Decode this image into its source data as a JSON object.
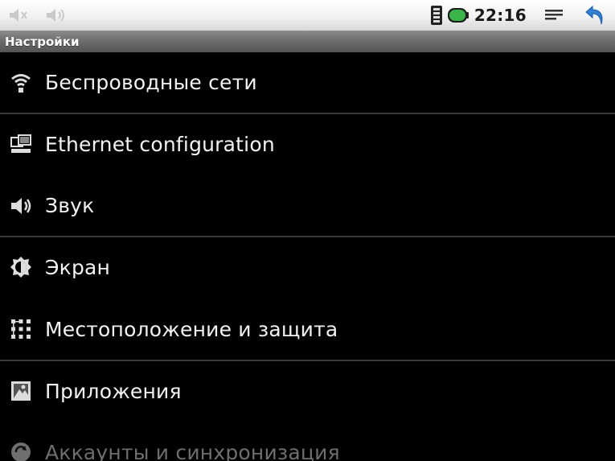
{
  "status_bar": {
    "left_icons": [
      "volume-muted-icon",
      "volume-low-icon"
    ],
    "clock": "22:16",
    "right_icons": [
      "sim-signal-icon",
      "battery-icon",
      "menu-icon",
      "back-icon"
    ],
    "colors": {
      "battery_fill": "#39b54a",
      "back_arrow": "#2f7fd8"
    }
  },
  "title_bar": {
    "title": "Настройки"
  },
  "settings": {
    "items": [
      {
        "label": "Беспроводные сети",
        "icon": "wifi-icon"
      },
      {
        "label": "Ethernet configuration",
        "icon": "ethernet-icon"
      },
      {
        "label": "Звук",
        "icon": "speaker-icon"
      },
      {
        "label": "Экран",
        "icon": "brightness-icon"
      },
      {
        "label": "Местоположение и защита",
        "icon": "location-grid-icon"
      },
      {
        "label": "Приложения",
        "icon": "applications-icon"
      },
      {
        "label": "Аккаунты и синхронизация",
        "icon": "sync-icon"
      }
    ]
  }
}
